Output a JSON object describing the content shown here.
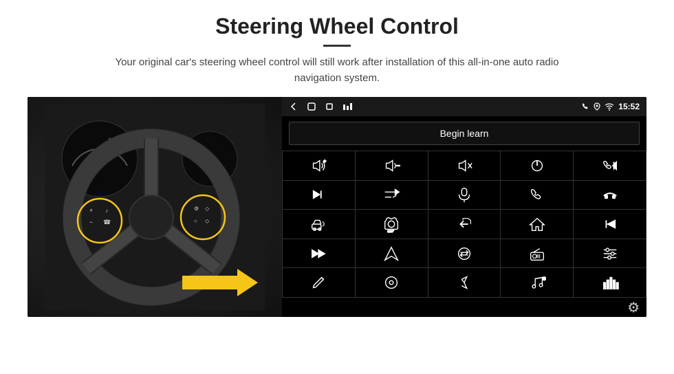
{
  "page": {
    "title": "Steering Wheel Control",
    "divider": true,
    "subtitle": "Your original car's steering wheel control will still work after installation of this all-in-one auto radio navigation system."
  },
  "status_bar": {
    "time": "15:52",
    "icons": [
      "back-icon",
      "home-square-icon",
      "recent-apps-icon",
      "sim-icon"
    ]
  },
  "begin_learn": {
    "label": "Begin learn"
  },
  "icons_grid": [
    {
      "id": "vol-up",
      "label": "Volume Up"
    },
    {
      "id": "vol-down",
      "label": "Volume Down"
    },
    {
      "id": "vol-mute",
      "label": "Volume Mute"
    },
    {
      "id": "power",
      "label": "Power"
    },
    {
      "id": "prev-track",
      "label": "Previous Track"
    },
    {
      "id": "skip-next",
      "label": "Skip Next"
    },
    {
      "id": "shuffle",
      "label": "Shuffle"
    },
    {
      "id": "mic",
      "label": "Microphone"
    },
    {
      "id": "phone",
      "label": "Phone"
    },
    {
      "id": "hang-up",
      "label": "Hang Up"
    },
    {
      "id": "horn",
      "label": "Horn/Speaker"
    },
    {
      "id": "camera360",
      "label": "360 Camera"
    },
    {
      "id": "back",
      "label": "Back"
    },
    {
      "id": "home",
      "label": "Home"
    },
    {
      "id": "skip-back",
      "label": "Skip Back"
    },
    {
      "id": "fast-forward",
      "label": "Fast Forward"
    },
    {
      "id": "navigate",
      "label": "Navigate"
    },
    {
      "id": "equalizer",
      "label": "Equalizer"
    },
    {
      "id": "radio",
      "label": "Radio"
    },
    {
      "id": "settings-sliders",
      "label": "Settings Sliders"
    },
    {
      "id": "edit",
      "label": "Edit"
    },
    {
      "id": "cd",
      "label": "CD/Disc"
    },
    {
      "id": "bluetooth",
      "label": "Bluetooth"
    },
    {
      "id": "music",
      "label": "Music"
    },
    {
      "id": "spectrum",
      "label": "Spectrum/Equalizer"
    }
  ],
  "settings_gear": {
    "label": "Settings"
  }
}
